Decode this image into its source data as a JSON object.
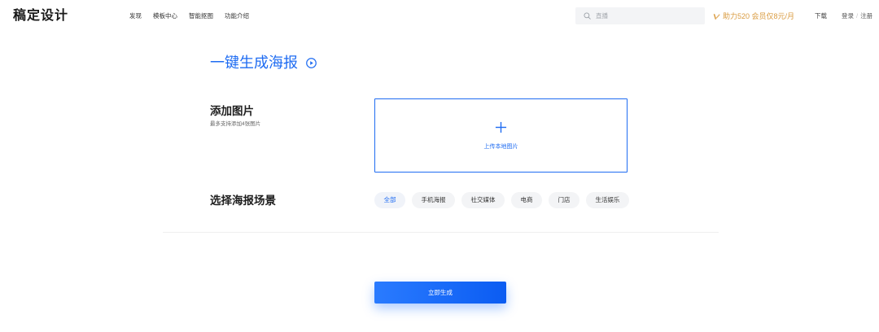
{
  "header": {
    "logo": "稿定设计",
    "nav": [
      {
        "label": "发现"
      },
      {
        "label": "模板中心"
      },
      {
        "label": "智能抠图"
      },
      {
        "label": "功能介绍"
      }
    ],
    "search": {
      "icon": "search-icon",
      "placeholder": "直播"
    },
    "promo": {
      "icon": "vip-icon",
      "text": "助力520 会员仅8元/月"
    },
    "download": "下载",
    "login": "登录",
    "separator": "/",
    "register": "注册"
  },
  "main": {
    "title": "一键生成海报",
    "title_icon": "play-circle-icon",
    "add_images": {
      "heading": "添加图片",
      "hint": "最多支持添加4张图片"
    },
    "upload": {
      "icon": "plus-icon",
      "label": "上传本地图片"
    },
    "scene": {
      "heading": "选择海报场景",
      "options": [
        {
          "label": "全部",
          "active": true
        },
        {
          "label": "手机海报",
          "active": false
        },
        {
          "label": "社交媒体",
          "active": false
        },
        {
          "label": "电商",
          "active": false
        },
        {
          "label": "门店",
          "active": false
        },
        {
          "label": "生活娱乐",
          "active": false
        }
      ]
    },
    "generate_button": "立即生成"
  },
  "colors": {
    "accent": "#1f6cf2",
    "promo": "#d99a3e",
    "button_gradient": [
      "#2a7bff",
      "#0b5cf2"
    ]
  }
}
